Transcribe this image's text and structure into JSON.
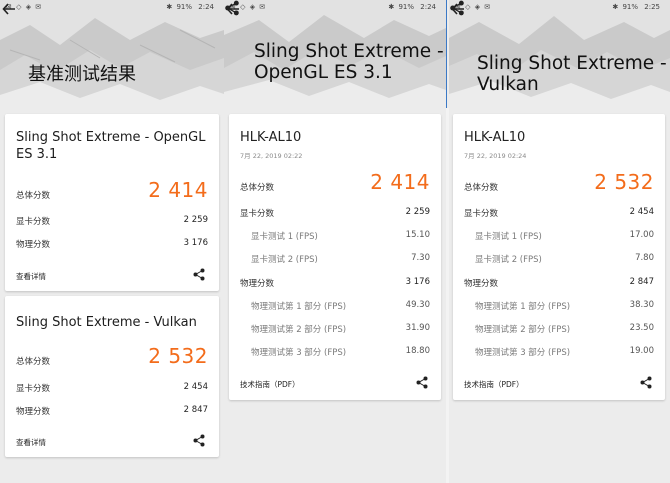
{
  "statusbar": {
    "icons_left": "⊠ ◇ ◈ ✉",
    "panel1": {
      "bt": "✱",
      "battery": "91%",
      "time": "2:24"
    },
    "panel2": {
      "bt": "✱",
      "battery": "91%",
      "time": "2:24"
    },
    "panel3": {
      "bt": "✱",
      "battery": "91%",
      "time": "2:25"
    }
  },
  "accent_color": "#f36c1b",
  "panel1": {
    "title": "基准测试结果",
    "cards": [
      {
        "title": "Sling Shot Extreme - OpenGL ES 3.1",
        "total_label": "总体分数",
        "total_value": "2 414",
        "graphics_label": "显卡分数",
        "graphics_value": "2 259",
        "physics_label": "物理分数",
        "physics_value": "3 176",
        "link": "查看详情"
      },
      {
        "title": "Sling Shot Extreme - Vulkan",
        "total_label": "总体分数",
        "total_value": "2 532",
        "graphics_label": "显卡分数",
        "graphics_value": "2 454",
        "physics_label": "物理分数",
        "physics_value": "2 847",
        "link": "查看详情"
      }
    ]
  },
  "panel2": {
    "title": "Sling Shot Extreme - OpenGL ES 3.1",
    "device": "HLK-AL10",
    "date": "7月 22, 2019 02:22",
    "total_label": "总体分数",
    "total_value": "2 414",
    "graphics_label": "显卡分数",
    "graphics_value": "2 259",
    "gt1_label": "显卡测试 1 (FPS)",
    "gt1_value": "15.10",
    "gt2_label": "显卡测试 2 (FPS)",
    "gt2_value": "7.30",
    "physics_label": "物理分数",
    "physics_value": "3 176",
    "pt1_label": "物理测试第 1 部分 (FPS)",
    "pt1_value": "49.30",
    "pt2_label": "物理测试第 2 部分 (FPS)",
    "pt2_value": "31.90",
    "pt3_label": "物理测试第 3 部分 (FPS)",
    "pt3_value": "18.80",
    "link": "技术指南（PDF）"
  },
  "panel3": {
    "title": "Sling Shot Extreme - Vulkan",
    "device": "HLK-AL10",
    "date": "7月 22, 2019 02:24",
    "total_label": "总体分数",
    "total_value": "2 532",
    "graphics_label": "显卡分数",
    "graphics_value": "2 454",
    "gt1_label": "显卡测试 1 (FPS)",
    "gt1_value": "17.00",
    "gt2_label": "显卡测试 2 (FPS)",
    "gt2_value": "7.80",
    "physics_label": "物理分数",
    "physics_value": "2 847",
    "pt1_label": "物理测试第 1 部分 (FPS)",
    "pt1_value": "38.30",
    "pt2_label": "物理测试第 2 部分 (FPS)",
    "pt2_value": "23.50",
    "pt3_label": "物理测试第 3 部分 (FPS)",
    "pt3_value": "19.00",
    "link": "技术指南（PDF）"
  }
}
